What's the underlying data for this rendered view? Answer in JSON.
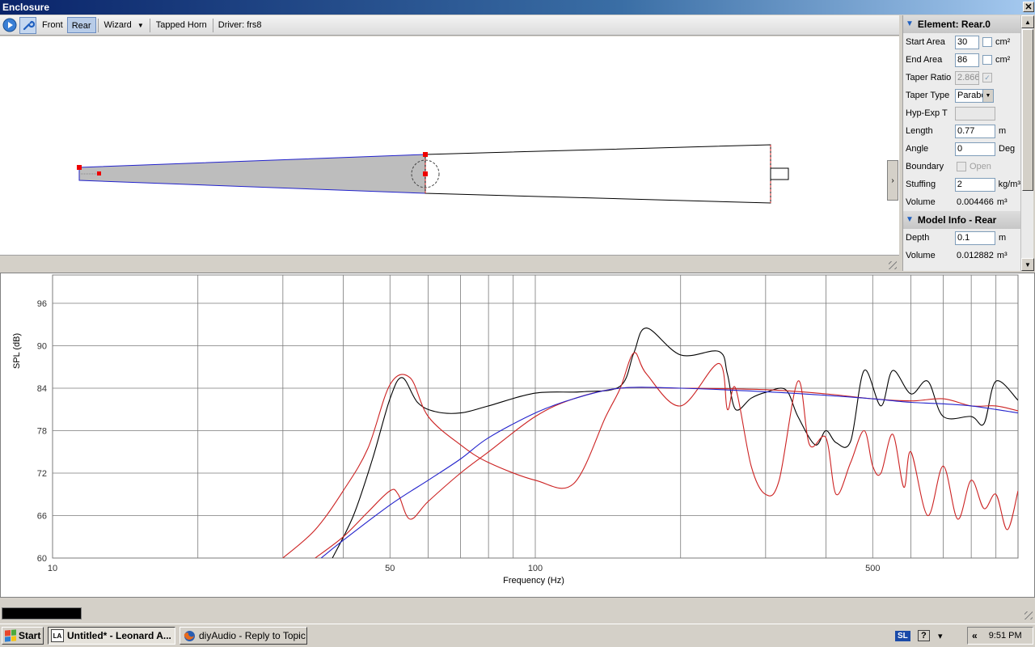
{
  "window": {
    "title": "Enclosure",
    "close_glyph": "✕"
  },
  "toolbar": {
    "icons": [
      "play-icon",
      "wrench-icon"
    ],
    "front_label": "Front",
    "rear_label": "Rear",
    "wizard_label": "Wizard",
    "tapped_horn_label": "Tapped Horn",
    "driver_label": "Driver: frs8"
  },
  "properties": {
    "element_header": "Element: Rear.0",
    "start_area": {
      "label": "Start Area",
      "value": "30",
      "unit": "cm²"
    },
    "end_area": {
      "label": "End Area",
      "value": "86",
      "unit": "cm²"
    },
    "taper_ratio": {
      "label": "Taper Ratio",
      "value": "2.866"
    },
    "taper_type": {
      "label": "Taper Type",
      "value": "Parabolic"
    },
    "hyp_exp": {
      "label": "Hyp-Exp T",
      "value": ""
    },
    "length": {
      "label": "Length",
      "value": "0.77",
      "unit": "m"
    },
    "angle": {
      "label": "Angle",
      "value": "0",
      "unit": "Deg"
    },
    "boundary": {
      "label": "Boundary",
      "option": "Open"
    },
    "stuffing": {
      "label": "Stuffing",
      "value": "2",
      "unit": "kg/m³"
    },
    "volume": {
      "label": "Volume",
      "value": "0.004466",
      "unit": "m³"
    },
    "model_header": "Model Info - Rear",
    "depth": {
      "label": "Depth",
      "value": "0.1",
      "unit": "m"
    },
    "model_volume": {
      "label": "Volume",
      "value": "0.012882",
      "unit": "m³"
    }
  },
  "chart_data": {
    "type": "line",
    "xlabel": "Frequency (Hz)",
    "ylabel": "SPL (dB)",
    "xscale": "log",
    "xlim": [
      10,
      1000
    ],
    "ylim": [
      60,
      100
    ],
    "xticks": [
      10,
      50,
      100,
      500
    ],
    "yticks": [
      60,
      66,
      72,
      78,
      84,
      90,
      96
    ],
    "grid": true,
    "series": [
      {
        "color": "#000000",
        "x": [
          38,
          42,
          46,
          50,
          53,
          57,
          62,
          70,
          80,
          100,
          125,
          150,
          160,
          170,
          200,
          240,
          250,
          260,
          280,
          300,
          330,
          350,
          380,
          400,
          420,
          450,
          480,
          520,
          550,
          600,
          650,
          700,
          800,
          850,
          900,
          1000
        ],
        "y": [
          60,
          66,
          74,
          82.5,
          85.5,
          82,
          80.7,
          80.5,
          81.5,
          83.3,
          83.5,
          84.3,
          89,
          92.5,
          88.7,
          89.2,
          86,
          81,
          82.6,
          83.4,
          83.8,
          80,
          76,
          78,
          76.3,
          76.5,
          86.5,
          81.5,
          86.5,
          83.2,
          85,
          80,
          80,
          79,
          85,
          82.3
        ]
      },
      {
        "color": "#cc2222",
        "x": [
          30,
          35,
          40,
          45,
          50,
          55,
          60,
          70,
          80,
          100,
          120,
          140,
          150,
          160,
          170,
          200,
          240,
          250,
          260,
          280,
          300,
          320,
          350,
          370,
          400,
          420,
          450,
          480,
          500,
          520,
          550,
          580,
          600,
          650,
          700,
          750,
          800,
          850,
          900,
          950,
          1000
        ],
        "y": [
          60,
          64,
          69.5,
          75.5,
          84.5,
          85.5,
          80,
          76,
          73.5,
          71,
          70.5,
          80,
          84,
          89,
          86,
          81.5,
          87.5,
          81,
          84,
          73,
          69,
          71,
          85,
          76,
          77,
          69,
          73.5,
          78,
          73,
          72,
          77.5,
          70,
          75,
          66,
          73,
          65.5,
          71,
          67,
          69,
          64,
          69.5
        ]
      },
      {
        "color": "#cc2222",
        "x": [
          35,
          40,
          45,
          50,
          52,
          55,
          60,
          70,
          80,
          100,
          120,
          150,
          200,
          300,
          400,
          500,
          600,
          700,
          800,
          900,
          1000
        ],
        "y": [
          60,
          63,
          66.5,
          69.5,
          69,
          65.5,
          68,
          72,
          75,
          80,
          82.5,
          84,
          84,
          83.8,
          83.2,
          82.5,
          82.2,
          82.5,
          81.5,
          81.5,
          80.8
        ]
      },
      {
        "color": "#2222cc",
        "x": [
          36,
          40,
          50,
          60,
          70,
          80,
          100,
          120,
          150,
          200,
          300,
          400,
          500,
          600,
          700,
          800,
          900,
          1000
        ],
        "y": [
          60,
          62.5,
          67.5,
          71,
          74,
          77,
          80.5,
          82.5,
          84,
          84,
          83.5,
          83,
          82.5,
          82,
          81.8,
          81.5,
          81,
          80.5
        ]
      }
    ]
  }
}
